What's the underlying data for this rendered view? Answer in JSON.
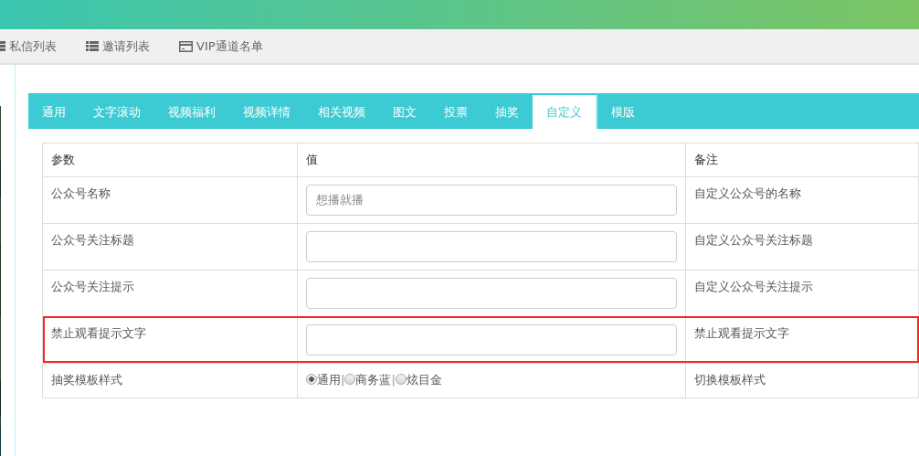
{
  "top_nav": [
    {
      "label": "私信列表",
      "kind": "list"
    },
    {
      "label": "邀请列表",
      "kind": "list"
    },
    {
      "label": "VIP通道名单",
      "kind": "card"
    }
  ],
  "tabs": [
    {
      "label": "通用",
      "selected": false
    },
    {
      "label": "文字滚动",
      "selected": false
    },
    {
      "label": "视频福利",
      "selected": false
    },
    {
      "label": "视频详情",
      "selected": false
    },
    {
      "label": "相关视频",
      "selected": false
    },
    {
      "label": "图文",
      "selected": false
    },
    {
      "label": "投票",
      "selected": false
    },
    {
      "label": "抽奖",
      "selected": false
    },
    {
      "label": "自定义",
      "selected": true
    },
    {
      "label": "模版",
      "selected": false
    }
  ],
  "table": {
    "columns": [
      "参数",
      "值",
      "备注"
    ],
    "rows": [
      {
        "param": "公众号名称",
        "kind": "text",
        "placeholder": "想播就播",
        "note": "自定义公众号的名称",
        "highlighted": false
      },
      {
        "param": "公众号关注标题",
        "kind": "text",
        "note": "自定义公众号关注标题",
        "highlighted": false
      },
      {
        "param": "公众号关注提示",
        "kind": "text",
        "note": "自定义公众号关注提示",
        "highlighted": false
      },
      {
        "param": "禁止观看提示文字",
        "kind": "text",
        "note": "禁止观看提示文字",
        "highlighted": true
      },
      {
        "param": "抽奖模板样式",
        "kind": "radio",
        "options": [
          {
            "label": "通用",
            "selected": true
          },
          {
            "label": "商务蓝",
            "selected": false
          },
          {
            "label": "炫目金",
            "selected": false
          }
        ],
        "separator": "|",
        "note": "切换模板样式",
        "highlighted": false
      }
    ]
  }
}
